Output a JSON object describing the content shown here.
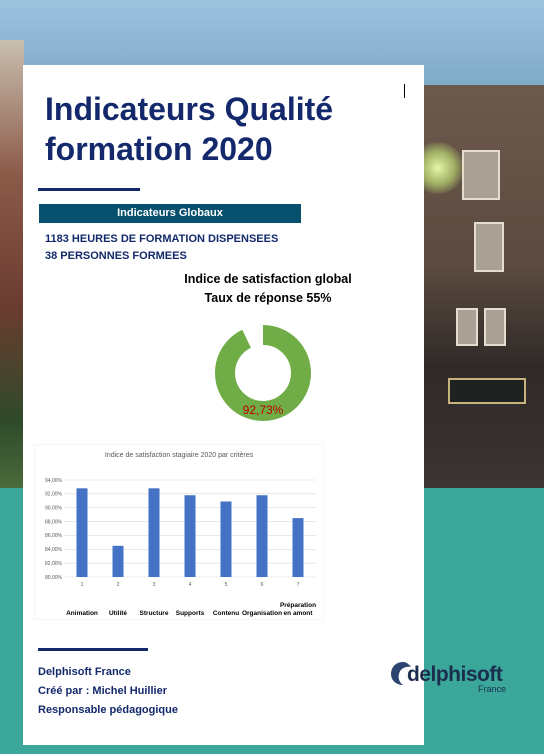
{
  "document": {
    "title_line1": "Indicateurs Qualité",
    "title_line2": "formation 2020",
    "section_title": "Indicateurs Globaux",
    "stats": [
      "1183 HEURES DE FORMATION DISPENSEES",
      "38 PERSONNES FORMEES"
    ],
    "satisfaction_title": "Indice de satisfaction global",
    "response_rate": "Taux de réponse 55%",
    "donut_value": 92.73,
    "donut_label": "92,73%",
    "footer": {
      "company": "Delphisoft France",
      "created_by": "Créé par : Michel Huillier",
      "role": "Responsable pédagogique"
    },
    "logo": {
      "name": "delphisoft",
      "sub": "France"
    }
  },
  "colors": {
    "navy": "#13296c",
    "section_bar": "#08516e",
    "donut_green": "#70ad47",
    "donut_label": "#c00000",
    "bar_blue": "#4472c4",
    "teal_background": "#3aa79a"
  },
  "chart_data": {
    "type": "bar",
    "title": "Indice de satisfaction stagiaire 2020 par critères",
    "categories": [
      "1",
      "2",
      "3",
      "4",
      "5",
      "6",
      "7"
    ],
    "category_labels": [
      "Animation",
      "Utilité",
      "Structure",
      "Supports",
      "Contenu",
      "Organisation",
      "Préparation en amont"
    ],
    "values": [
      92.8,
      84.5,
      92.8,
      91.8,
      90.9,
      91.8,
      88.5
    ],
    "ylim": [
      80,
      94
    ],
    "yticks": [
      "80,00%",
      "82,00%",
      "84,00%",
      "86,00%",
      "88,00%",
      "90,00%",
      "92,00%",
      "94,00%"
    ],
    "grid": true
  }
}
